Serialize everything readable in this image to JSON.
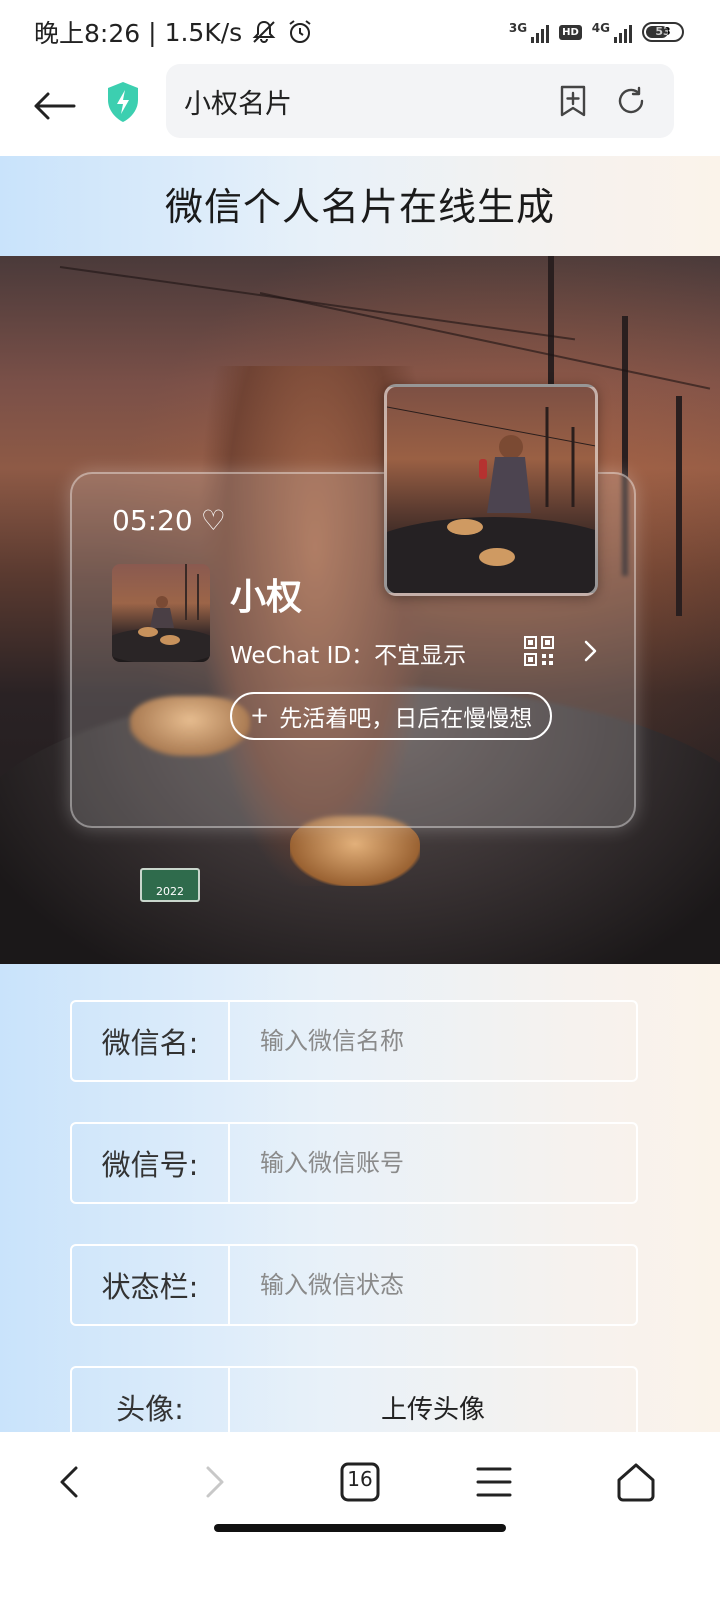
{
  "status_bar": {
    "time": "晚上8:26",
    "speed": "1.5K/s",
    "net1": "3G",
    "hd": "HD",
    "net2": "4G",
    "battery": "53"
  },
  "browser": {
    "url_title": "小权名片",
    "tab_count": "16"
  },
  "page": {
    "title": "微信个人名片在线生成"
  },
  "card": {
    "time": "05:20",
    "heart_icon": "♡",
    "name": "小权",
    "wechat_id": "WeChat ID：不宜显示",
    "status_prefix": "+",
    "status": "先活着吧，日后在慢慢想"
  },
  "form": {
    "wechat_name": {
      "label": "微信名:",
      "placeholder": "输入微信名称"
    },
    "wechat_id": {
      "label": "微信号:",
      "placeholder": "输入微信账号"
    },
    "status": {
      "label": "状态栏:",
      "placeholder": "输入微信状态"
    },
    "avatar": {
      "label": "头像:",
      "button": "上传头像"
    }
  },
  "plate_text": "2022",
  "colors": {
    "accent_shield": "#3ccfb0",
    "page_gradient_left": "#c9e3fb",
    "page_gradient_right": "#fbf3ea"
  }
}
